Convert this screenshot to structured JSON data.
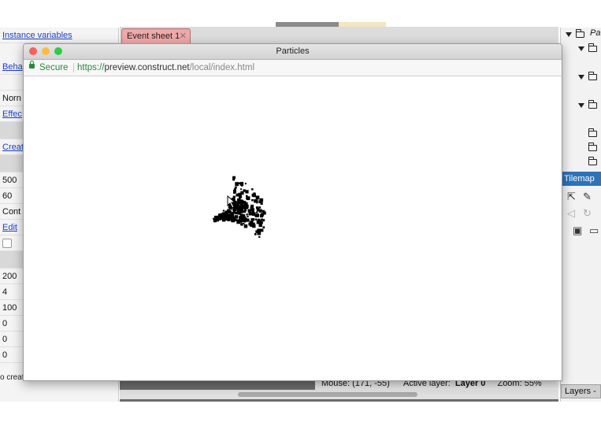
{
  "left_panel": {
    "rows": [
      {
        "text": "Instance variables",
        "kind": "link"
      },
      {
        "text": "Beha",
        "kind": "link"
      },
      {
        "text": "Norn",
        "kind": "text"
      },
      {
        "text": "Effec",
        "kind": "link"
      },
      {
        "text": "Creat",
        "kind": "link"
      },
      {
        "text": "500",
        "kind": "text"
      },
      {
        "text": "60",
        "kind": "text"
      },
      {
        "text": "Cont",
        "kind": "text"
      },
      {
        "text": "Edit",
        "kind": "link"
      },
      {
        "text": "200",
        "kind": "text"
      },
      {
        "text": "4",
        "kind": "text"
      },
      {
        "text": "100",
        "kind": "text"
      },
      {
        "text": "0",
        "kind": "text"
      },
      {
        "text": "0",
        "kind": "text"
      },
      {
        "text": "0",
        "kind": "text"
      }
    ],
    "status_text": "o create per second, or total"
  },
  "editor": {
    "tab_label": "Event sheet 1",
    "status": {
      "mouse": "Mouse: (171, -55)",
      "active_layer_label": "Active layer:",
      "active_layer_value": "Layer 0",
      "zoom": "Zoom: 55%"
    }
  },
  "right_panel": {
    "partial_label": "Pa",
    "tilemap_label": "Tilemap",
    "layers_label": "Layers -"
  },
  "browser": {
    "title": "Particles",
    "secure_label": "Secure",
    "url_scheme": "https://",
    "url_host": "preview.construct.net",
    "url_path": "/local/index.html"
  },
  "colors": {
    "traffic_red": "#fc605b",
    "traffic_yellow": "#fdbc40",
    "traffic_green": "#34c84a",
    "secure_green": "#2b8a3e",
    "link_blue": "#1a3fd1",
    "tilemap_blue": "#2e73b8",
    "tab_pink": "#f0a8a8"
  }
}
